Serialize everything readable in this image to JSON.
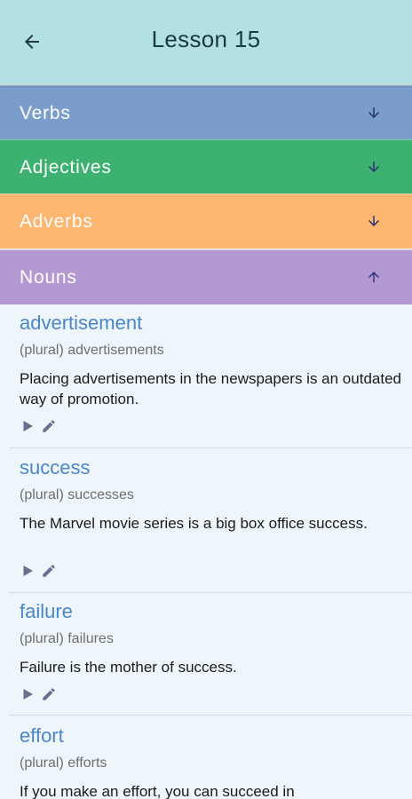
{
  "header": {
    "title": "Lesson 15",
    "back_icon": "arrow-back-icon",
    "color": "#b2e0e4"
  },
  "categories": [
    {
      "label": "Verbs",
      "color": "#7b9dcc",
      "arrow": "arrow-down-icon"
    },
    {
      "label": "Adjectives",
      "color": "#3db16f",
      "arrow": "arrow-down-icon"
    },
    {
      "label": "Adverbs",
      "color": "#fdb66f",
      "arrow": "arrow-down-icon"
    },
    {
      "label": "Nouns",
      "color": "#b398d2",
      "arrow": "arrow-up-icon",
      "expanded": true
    }
  ],
  "words": [
    {
      "word": "advertisement",
      "plural": "(plural) advertisements",
      "example": "Placing advertisements in the newspapers is an outdated way of promotion."
    },
    {
      "word": "success",
      "plural": "(plural) successes",
      "example": "The Marvel movie series is a big box office success."
    },
    {
      "word": "failure",
      "plural": "(plural) failures",
      "example": "Failure is the mother of success."
    },
    {
      "word": "effort",
      "plural": "(plural) efforts",
      "example": "If you make an effort, you can succeed in"
    }
  ]
}
